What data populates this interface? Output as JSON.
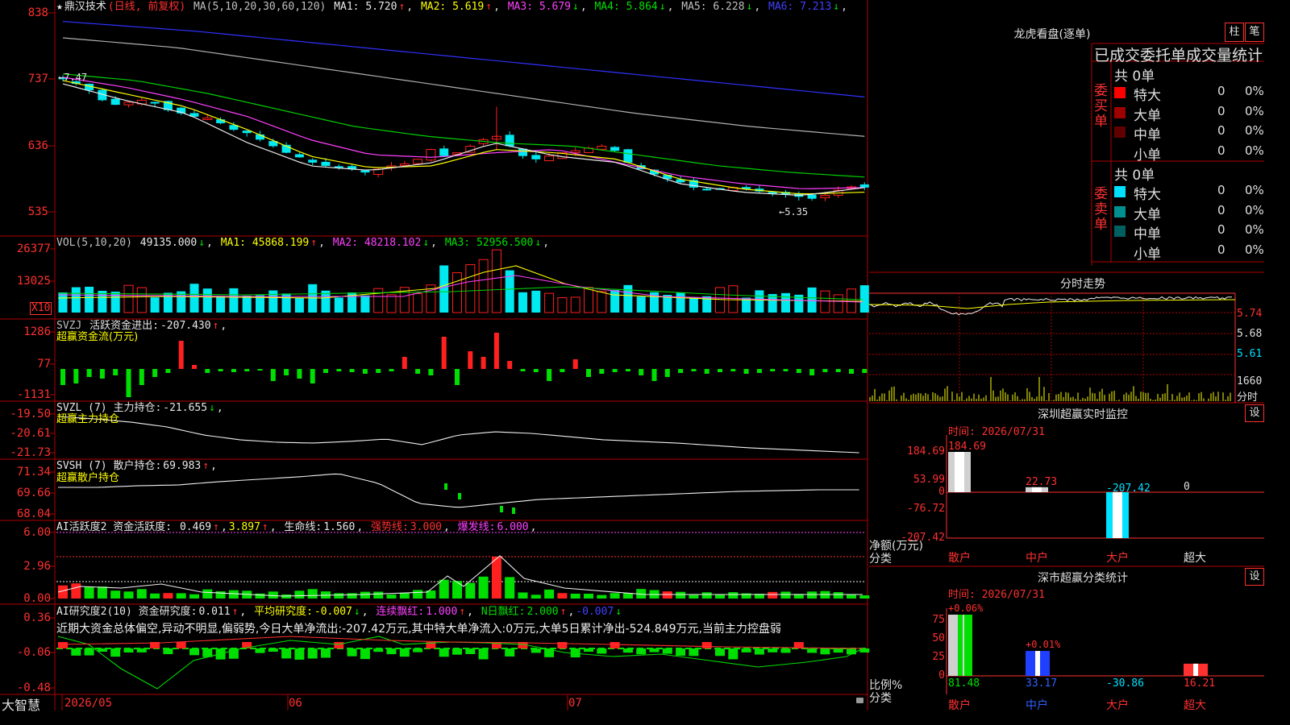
{
  "stock": {
    "name": "鼎汉技术",
    "period": "(日线, 前复权)"
  },
  "main_indicator": {
    "label": "MA(5,10,20,30,60,120)",
    "items": [
      {
        "name": "MA1:",
        "value": "5.720",
        "arrow": "↑",
        "color": "#e8e8e8",
        "arrow_color": "#ff3030"
      },
      {
        "name": "MA2:",
        "value": "5.619",
        "arrow": "↑",
        "color": "#ffff00",
        "arrow_color": "#ff3030"
      },
      {
        "name": "MA3:",
        "value": "5.679",
        "arrow": "↓",
        "color": "#ff40ff",
        "arrow_color": "#00e000"
      },
      {
        "name": "MA4:",
        "value": "5.864",
        "arrow": "↓",
        "color": "#00e000",
        "arrow_color": "#00e000"
      },
      {
        "name": "MA5:",
        "value": "6.228",
        "arrow": "↓",
        "color": "#c0c0c0",
        "arrow_color": "#00e000"
      },
      {
        "name": "MA6:",
        "value": "7.213",
        "arrow": "↓",
        "color": "#4040ff",
        "arrow_color": "#00e000"
      }
    ],
    "y_labels": [
      "838",
      "737",
      "636",
      "535"
    ],
    "high_marker": "7.47",
    "low_marker": "5.35",
    "high_marker_prefix": "←",
    "low_marker_prefix": "←"
  },
  "volume": {
    "label": "VOL(5,10,20)",
    "value": "49135.000",
    "value_arrow": "↓",
    "ma": [
      {
        "name": "MA1:",
        "value": "45868.199",
        "arrow": "↑",
        "color": "#ffff00"
      },
      {
        "name": "MA2:",
        "value": "48218.102",
        "arrow": "↓",
        "color": "#ff40ff"
      },
      {
        "name": "MA3:",
        "value": "52956.500",
        "arrow": "↓",
        "color": "#00e000"
      }
    ],
    "y_labels": [
      "26377",
      "13025"
    ],
    "unit": "X10"
  },
  "svzj": {
    "label": "SVZJ",
    "text": "活跃资金进出:",
    "value": "-207.430",
    "arrow": "↑",
    "sub": "超赢资金流(万元)",
    "y_labels": [
      "1286",
      "77",
      "-1131"
    ]
  },
  "svzl": {
    "label": "SVZL (7) 主力持仓:",
    "value": "-21.655",
    "arrow": "↓",
    "sub": "超赢主力持仓",
    "y_labels": [
      "-19.50",
      "-20.61",
      "-21.73"
    ]
  },
  "svsh": {
    "label": "SVSH (7) 散户持仓:",
    "value": "69.983",
    "arrow": "↑",
    "sub": "超赢散户持仓",
    "y_labels": [
      "71.34",
      "69.66",
      "68.04"
    ]
  },
  "ai_active": {
    "label": "AI活跃度2 资金活跃度:",
    "v1": "0.469",
    "v2": "3.897",
    "life_label": "生命线:",
    "life": "1.560",
    "strong_label": "强势线:",
    "strong": "3.000",
    "burst_label": "爆发线:",
    "burst": "6.000",
    "y_labels": [
      "6.00",
      "2.96",
      "0.00"
    ]
  },
  "ai_research": {
    "label": "AI研究度2(10) 资金研究度:",
    "v1": "0.011",
    "avg_label": "平均研究度:",
    "avg": "-0.007",
    "red_label": "连续飘红:",
    "red": "1.000",
    "n_label": "N日飘红:",
    "n": "2.000",
    "extra": "-0.007",
    "comment": "近期大资金总体偏空,异动不明显,偏弱势,今日大单净流出:-207.42万元,其中特大单净流入:0万元,大单5日累计净出-524.849万元,当前主力控盘弱",
    "y_labels": [
      "0.36",
      "-0.06",
      "-0.48"
    ]
  },
  "bottom": {
    "brand": "大智慧",
    "dates": [
      "2026/05",
      "06",
      "07"
    ]
  },
  "right": {
    "dragon_title": "龙虎看盘(逐单)",
    "btn_zhu": "柱",
    "btn_bi": "笔",
    "stat_title": "已成交委托单成交量统计",
    "buy": {
      "side": "委买单",
      "total": "共 0单",
      "rows": [
        {
          "label": "特大",
          "count": "0",
          "pct": "0%",
          "color": "#ff0000"
        },
        {
          "label": "大单",
          "count": "0",
          "pct": "0%",
          "color": "#a00000"
        },
        {
          "label": "中单",
          "count": "0",
          "pct": "0%",
          "color": "#600000"
        },
        {
          "label": "小单",
          "count": "0",
          "pct": "0%",
          "color": ""
        }
      ]
    },
    "sell": {
      "side": "委卖单",
      "total": "共 0单",
      "rows": [
        {
          "label": "特大",
          "count": "0",
          "pct": "0%",
          "color": "#00e0ff"
        },
        {
          "label": "大单",
          "count": "0",
          "pct": "0%",
          "color": "#009090"
        },
        {
          "label": "中单",
          "count": "0",
          "pct": "0%",
          "color": "#006060"
        },
        {
          "label": "小单",
          "count": "0",
          "pct": "0%",
          "color": ""
        }
      ]
    },
    "intraday": {
      "title": "分时走势",
      "y_labels": [
        "5.74",
        "5.68",
        "5.61"
      ],
      "vol_label": "1660",
      "vol_unit": "分时"
    },
    "monitor": {
      "title": "深圳超赢实时监控",
      "set": "设",
      "time": "时间: 2026/07/31",
      "y_labels": [
        "184.69",
        "53.99",
        "0",
        "-76.72",
        "-207.42"
      ],
      "axis_title": "净额(万元)",
      "axis_sub": "分类",
      "bars": [
        {
          "cat": "散户",
          "value": 184.69,
          "label": "184.69"
        },
        {
          "cat": "中户",
          "value": 22.73,
          "label": "22.73"
        },
        {
          "cat": "大户",
          "value": -207.42,
          "label": "-207.42"
        },
        {
          "cat": "超大",
          "value": 0,
          "label": "0"
        }
      ]
    },
    "classify": {
      "title": "深市超赢分类统计",
      "set": "设",
      "time": "时间: 2026/07/31",
      "y_labels": [
        "75",
        "50",
        "25",
        "0"
      ],
      "axis_title": "比例%",
      "axis_sub": "分类",
      "bars": [
        {
          "cat": "散户",
          "value": 81.48,
          "top": "+0.06%",
          "bottom": "81.48"
        },
        {
          "cat": "中户",
          "value": 33.17,
          "top": "+0.01%",
          "bottom": "33.17"
        },
        {
          "cat": "大户",
          "value": -30.86,
          "top": "",
          "bottom": "-30.86"
        },
        {
          "cat": "超大",
          "value": 16.21,
          "top": "",
          "bottom": "16.21"
        }
      ]
    }
  }
}
